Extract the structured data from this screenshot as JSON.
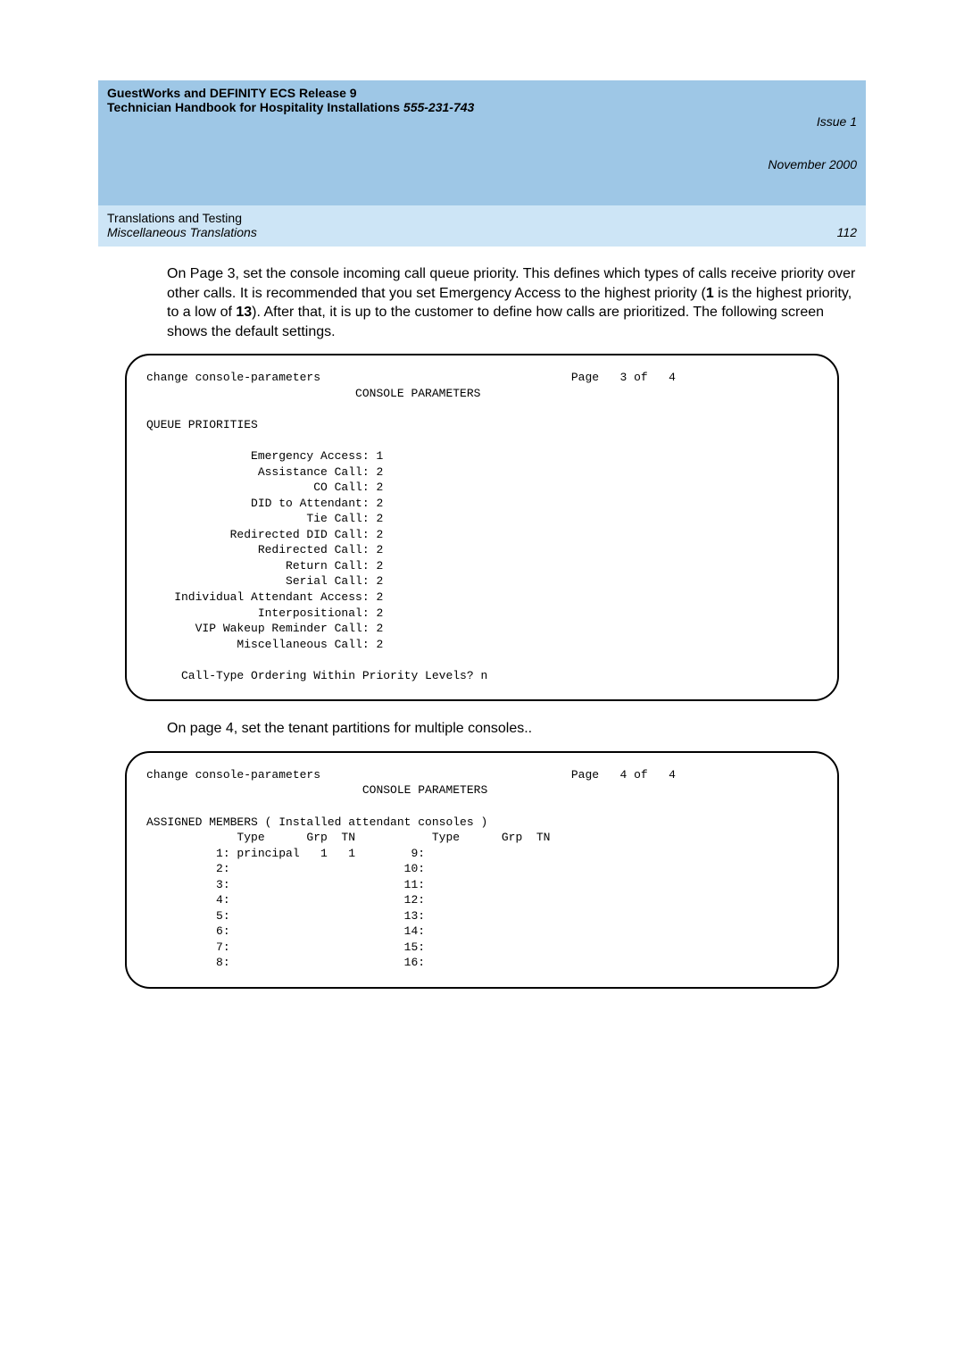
{
  "header": {
    "title_line1": "GuestWorks and DEFINITY ECS Release 9",
    "title_line2_prefix": "Technician Handbook for Hospitality Installations  ",
    "doc_number": "555-231-743",
    "issue": "Issue 1",
    "date": "November 2000",
    "section_title": "Translations and Testing",
    "subsection_title": "Miscellaneous Translations",
    "page_number": "112"
  },
  "paragraph1": {
    "pre": "On Page 3, set the console incoming call queue priority. This defines which types of calls receive priority over other calls. It is recommended that you set Emergency Access to the highest priority (",
    "bold1": "1",
    "mid": " is the highest priority, to a low of ",
    "bold2": "13",
    "post": "). After that, it is up to the customer to define how calls are prioritized. The following screen shows the default settings."
  },
  "terminal1": "change console-parameters                                    Page   3 of   4\n                              CONSOLE PARAMETERS\n\nQUEUE PRIORITIES\n\n               Emergency Access: 1\n                Assistance Call: 2\n                        CO Call: 2\n               DID to Attendant: 2\n                       Tie Call: 2\n            Redirected DID Call: 2\n                Redirected Call: 2\n                    Return Call: 2\n                    Serial Call: 2\n    Individual Attendant Access: 2\n                Interpositional: 2\n       VIP Wakeup Reminder Call: 2\n             Miscellaneous Call: 2\n\n     Call-Type Ordering Within Priority Levels? n",
  "paragraph2": "On page 4, set the tenant partitions for multiple consoles..",
  "terminal2": "change console-parameters                                    Page   4 of   4\n                               CONSOLE PARAMETERS\n\nASSIGNED MEMBERS ( Installed attendant consoles )\n             Type      Grp  TN           Type      Grp  TN\n          1: principal   1   1        9:\n          2:                         10:\n          3:                         11:\n          4:                         12:\n          5:                         13:\n          6:                         14:\n          7:                         15:\n          8:                         16:"
}
